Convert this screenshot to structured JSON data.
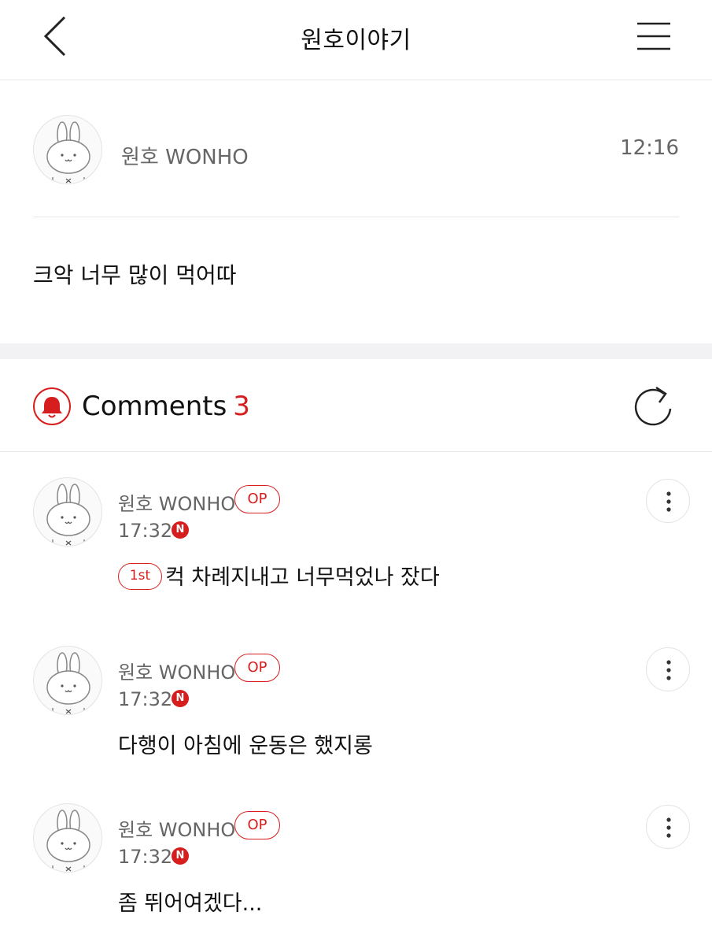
{
  "header": {
    "title": "원호이야기",
    "back_icon": "chevron-left-icon",
    "menu_icon": "hamburger-menu-icon"
  },
  "post": {
    "author": "원호 WONHO",
    "time": "12:16",
    "body": "크악 너무 많이 먹어따"
  },
  "comments_section": {
    "label": "Comments",
    "count": "3",
    "bell_icon": "bell-icon",
    "refresh_icon": "refresh-icon",
    "accent_color": "#d71e1e"
  },
  "comments": [
    {
      "author": "원호 WONHO",
      "badge": "OP",
      "time": "17:32",
      "new_badge": "N",
      "rank_badge": "1st",
      "text": "컥 차례지내고 너무먹었나 잤다"
    },
    {
      "author": "원호 WONHO",
      "badge": "OP",
      "time": "17:32",
      "new_badge": "N",
      "text": "다행이 아침에 운동은 했지롱"
    },
    {
      "author": "원호 WONHO",
      "badge": "OP",
      "time": "17:32",
      "new_badge": "N",
      "text": "좀 뛰어여겠다..."
    }
  ]
}
